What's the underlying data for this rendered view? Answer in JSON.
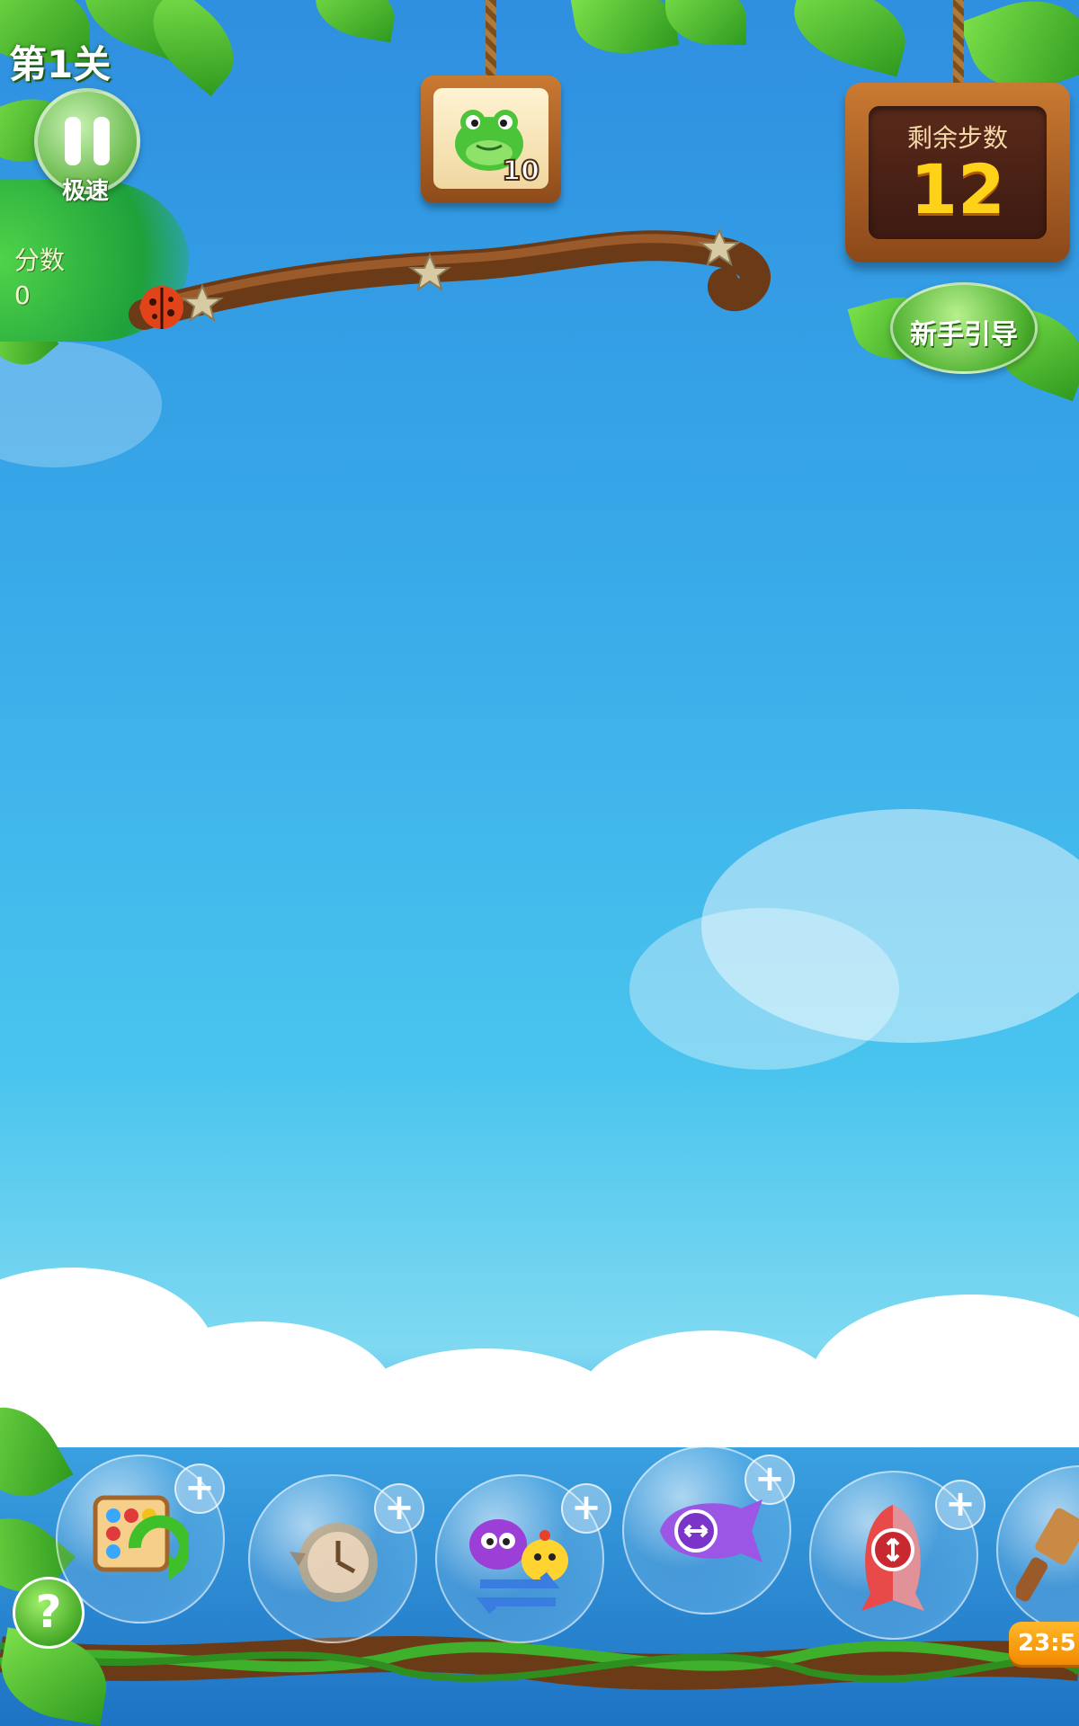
{
  "hud": {
    "level_title": "第1关",
    "speed_label": "极速",
    "score_label": "分数",
    "score_value": "0",
    "goal_count": "10",
    "moves_label": "剩余步数",
    "moves_value": "12",
    "guide_label": "新手引导"
  },
  "goal": {
    "icon": "frog-icon"
  },
  "progress": {
    "fraction": 0.0,
    "stars": 3
  },
  "boosters": [
    {
      "name": "shuffle-board",
      "icon": "shuffle-icon"
    },
    {
      "name": "time-clock",
      "icon": "clock-icon"
    },
    {
      "name": "swap-animals",
      "icon": "swap-icon"
    },
    {
      "name": "horizontal-rocket",
      "icon": "rocket-horizontal-icon"
    },
    {
      "name": "vertical-rocket",
      "icon": "rocket-vertical-icon"
    },
    {
      "name": "hammer",
      "icon": "hammer-icon"
    }
  ],
  "timer": "23:5",
  "help": "?",
  "colors": {
    "sky_top": "#2f8fe0",
    "leaf_green": "#4caf2e",
    "wood": "#8e4b1a",
    "moves_digits": "#ffd21a"
  }
}
